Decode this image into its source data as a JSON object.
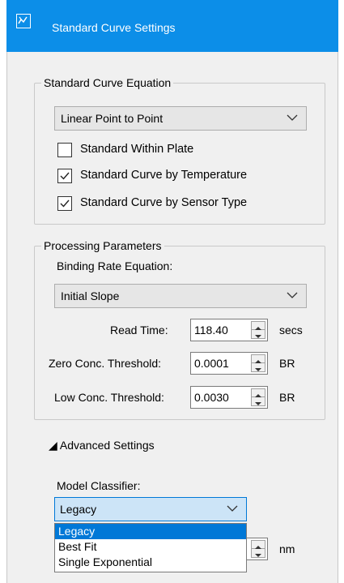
{
  "window": {
    "title": "Standard Curve Settings",
    "icon": "chart-window-icon"
  },
  "equation_group": {
    "legend": "Standard Curve Equation",
    "selected": "Linear Point to Point",
    "checkboxes": [
      {
        "label": "Standard Within Plate",
        "checked": false
      },
      {
        "label": "Standard Curve by Temperature",
        "checked": true
      },
      {
        "label": "Standard Curve by Sensor Type",
        "checked": true
      }
    ]
  },
  "processing_group": {
    "legend": "Processing Parameters",
    "binding_rate_label": "Binding Rate Equation:",
    "binding_rate_selected": "Initial Slope",
    "read_time": {
      "label": "Read Time:",
      "value": "118.40",
      "unit": "secs"
    },
    "zero_conc": {
      "label": "Zero Conc. Threshold:",
      "value": "0.0001",
      "unit": "BR"
    },
    "low_conc": {
      "label": "Low Conc. Threshold:",
      "value": "0.0030",
      "unit": "BR"
    }
  },
  "advanced": {
    "toggle_label": "◢ Advanced Settings",
    "model_classifier_label": "Model Classifier:",
    "model_classifier_selected": "Legacy",
    "options": [
      "Legacy",
      "Best Fit",
      "Single Exponential"
    ],
    "highlighted_index": 0,
    "hidden_field_unit": "nm"
  },
  "colors": {
    "title_bar": "#0c8ee8",
    "selection": "#0078d7",
    "panel_bg": "#f0f0f0"
  }
}
